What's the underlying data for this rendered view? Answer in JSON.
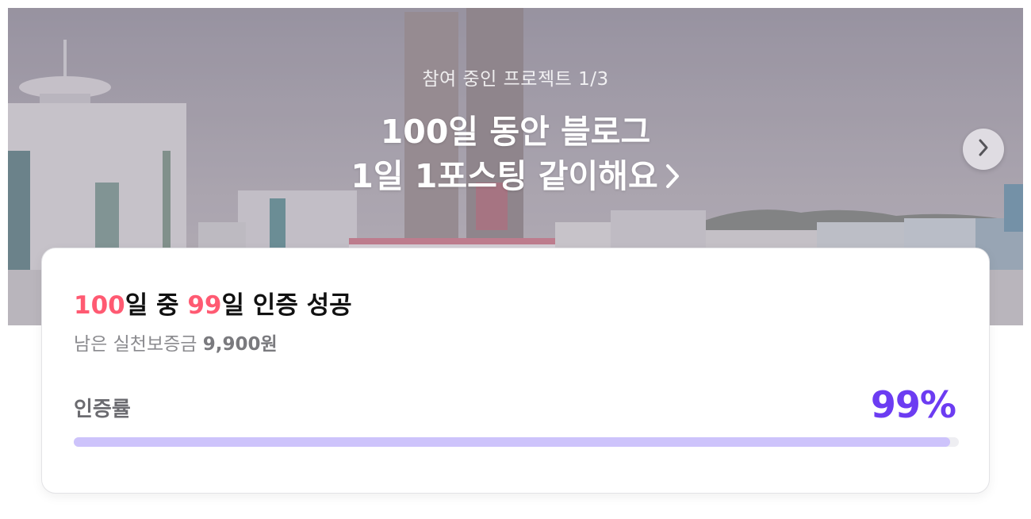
{
  "banner": {
    "subtitle": "참여 중인 프로젝트 1/3",
    "title_line1": "100일 동안 블로그",
    "title_line2": "1일 1포스팅 같이해요",
    "title_chevron_icon": "chevron-right-icon",
    "next_button_icon": "chevron-right-icon"
  },
  "status_card": {
    "total_days": "100",
    "headline_mid": "일 중 ",
    "success_days": "99",
    "headline_end": "일 인증 성공",
    "deposit_label": "남은 실천보증금 ",
    "deposit_value": "9,900원",
    "rate_label": "인증률",
    "rate_text": "99%",
    "progress": 0.99
  },
  "colors": {
    "accent_purple": "#6c3cf2",
    "highlight_pink": "#ff5a72",
    "progress_fill": "#cdc3fb",
    "progress_track": "#eeeef2"
  }
}
